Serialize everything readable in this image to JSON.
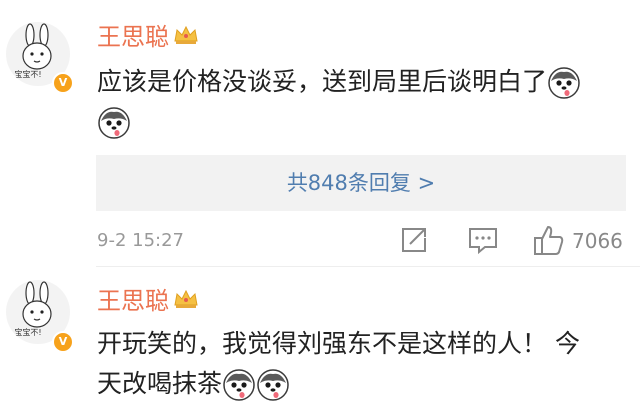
{
  "comments": [
    {
      "author": "王思聪",
      "avatar_caption": "宝宝不!",
      "badge": "V",
      "text": "应该是价格没谈妥，送到局里后谈明白了",
      "replies_link": "共848条回复 >",
      "timestamp": "9-2 15:27",
      "likes": "7066"
    },
    {
      "author": "王思聪",
      "avatar_caption": "宝宝不!",
      "badge": "V",
      "text_line1": "开玩笑的，我觉得刘强东不是这样的人！ 今",
      "text_line2": "天改喝抹茶"
    }
  ],
  "colors": {
    "name": "#eb7350",
    "link": "#507daf",
    "meta": "#999999",
    "badge": "#f7a21b"
  },
  "icons": [
    "rabbit-avatar",
    "crown-icon",
    "husky-emoji",
    "share-icon",
    "reply-icon",
    "thumbs-up-icon"
  ]
}
